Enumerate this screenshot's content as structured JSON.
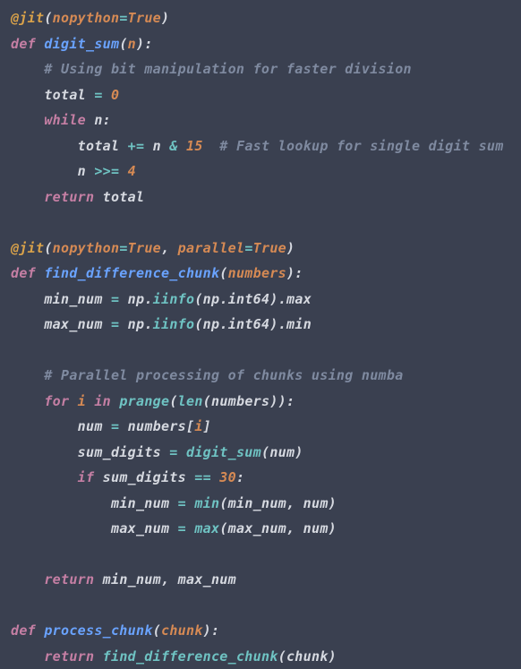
{
  "code": {
    "l1": {
      "dec": "@jit",
      "p1": "(",
      "arg1": "nopython",
      "eq": "=",
      "val1": "True",
      "p2": ")"
    },
    "l2": {
      "kw": "def ",
      "fn": "digit_sum",
      "p1": "(",
      "prm": "n",
      "p2": "):"
    },
    "l3": {
      "cm": "# Using bit manipulation for faster division"
    },
    "l4": {
      "id": "total ",
      "op": "=",
      "num": " 0"
    },
    "l5": {
      "kw": "while ",
      "id": "n",
      "p": ":"
    },
    "l6": {
      "id": "total ",
      "op1": "+=",
      "id2": " n ",
      "op2": "&",
      "num": " 15",
      "sp": "  ",
      "cm": "# Fast lookup for single digit sum"
    },
    "l7": {
      "id": "n ",
      "op": ">>=",
      "num": " 4"
    },
    "l8": {
      "kw": "return ",
      "id": "total"
    },
    "l9": {
      "dec": "@jit",
      "p1": "(",
      "arg1": "nopython",
      "eq1": "=",
      "val1": "True",
      "c": ", ",
      "arg2": "parallel",
      "eq2": "=",
      "val2": "True",
      "p2": ")"
    },
    "l10": {
      "kw": "def ",
      "fn": "find_difference_chunk",
      "p1": "(",
      "prm": "numbers",
      "p2": "):"
    },
    "l11": {
      "id1": "min_num ",
      "op": "=",
      "id2": " np",
      "d1": ".",
      "call1": "iinfo",
      "p1": "(",
      "id3": "np",
      "d2": ".",
      "id4": "int64",
      "p2": ")",
      "d3": ".",
      "id5": "max"
    },
    "l12": {
      "id1": "max_num ",
      "op": "=",
      "id2": " np",
      "d1": ".",
      "call1": "iinfo",
      "p1": "(",
      "id3": "np",
      "d2": ".",
      "id4": "int64",
      "p2": ")",
      "d3": ".",
      "id5": "min"
    },
    "l13": {
      "cm": "# Parallel processing of chunks using numba"
    },
    "l14": {
      "kw1": "for ",
      "prm": "i",
      "kw2": " in ",
      "call": "prange",
      "p1": "(",
      "call2": "len",
      "p2": "(",
      "id": "numbers",
      "p3": ")):"
    },
    "l15": {
      "id1": "num ",
      "op": "=",
      "id2": " numbers",
      "p1": "[",
      "prm": "i",
      "p2": "]"
    },
    "l16": {
      "id1": "sum_digits ",
      "op": "=",
      "sp": " ",
      "call": "digit_sum",
      "p1": "(",
      "id2": "num",
      "p2": ")"
    },
    "l17": {
      "kw": "if ",
      "id": "sum_digits ",
      "op": "==",
      "num": " 30",
      "p": ":"
    },
    "l18": {
      "id1": "min_num ",
      "op": "=",
      "sp": " ",
      "call": "min",
      "p1": "(",
      "id2": "min_num",
      "c": ", ",
      "id3": "num",
      "p2": ")"
    },
    "l19": {
      "id1": "max_num ",
      "op": "=",
      "sp": " ",
      "call": "max",
      "p1": "(",
      "id2": "max_num",
      "c": ", ",
      "id3": "num",
      "p2": ")"
    },
    "l20": {
      "kw": "return ",
      "id1": "min_num",
      "c": ", ",
      "id2": "max_num"
    },
    "l21": {
      "kw": "def ",
      "fn": "process_chunk",
      "p1": "(",
      "prm": "chunk",
      "p2": "):"
    },
    "l22": {
      "kw": "return ",
      "call": "find_difference_chunk",
      "p1": "(",
      "id": "chunk",
      "p2": ")"
    }
  }
}
